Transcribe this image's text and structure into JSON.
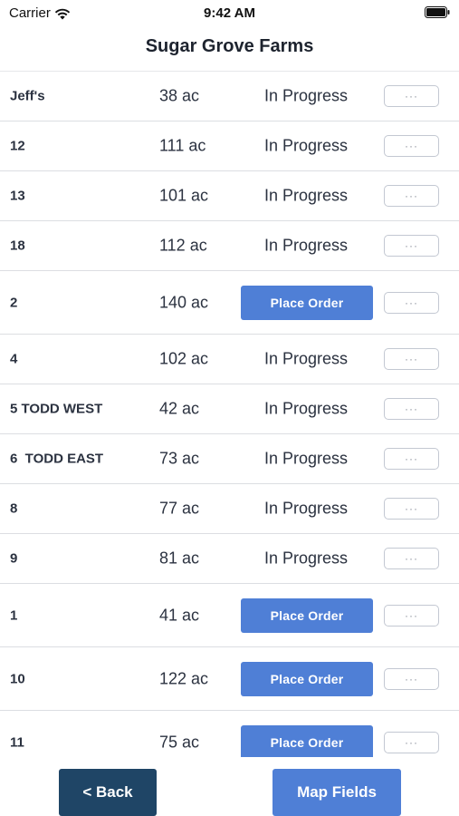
{
  "status_bar": {
    "carrier": "Carrier",
    "time": "9:42 AM"
  },
  "header": {
    "title": "Sugar Grove Farms"
  },
  "labels": {
    "more": "···"
  },
  "fields": [
    {
      "name": "Jeff's",
      "acres": "38 ac",
      "status": "In Progress",
      "action": null
    },
    {
      "name": "12",
      "acres": "111 ac",
      "status": "In Progress",
      "action": null
    },
    {
      "name": "13",
      "acres": "101 ac",
      "status": "In Progress",
      "action": null
    },
    {
      "name": "18",
      "acres": "112 ac",
      "status": "In Progress",
      "action": null
    },
    {
      "name": "2",
      "acres": "140 ac",
      "status": null,
      "action": "Place Order"
    },
    {
      "name": "4",
      "acres": "102 ac",
      "status": "In Progress",
      "action": null
    },
    {
      "name": "5 TODD WEST",
      "acres": "42 ac",
      "status": "In Progress",
      "action": null
    },
    {
      "name": "6  TODD EAST",
      "acres": "73 ac",
      "status": "In Progress",
      "action": null
    },
    {
      "name": "8",
      "acres": "77 ac",
      "status": "In Progress",
      "action": null
    },
    {
      "name": "9",
      "acres": "81 ac",
      "status": "In Progress",
      "action": null
    },
    {
      "name": "1",
      "acres": "41 ac",
      "status": null,
      "action": "Place Order"
    },
    {
      "name": "10",
      "acres": "122 ac",
      "status": null,
      "action": "Place Order"
    },
    {
      "name": "11",
      "acres": "75 ac",
      "status": null,
      "action": "Place Order"
    }
  ],
  "footer": {
    "back_label": "< Back",
    "map_fields_label": "Map Fields"
  },
  "colors": {
    "primary_button": "#4f7fd6",
    "back_button": "#1f4566"
  }
}
